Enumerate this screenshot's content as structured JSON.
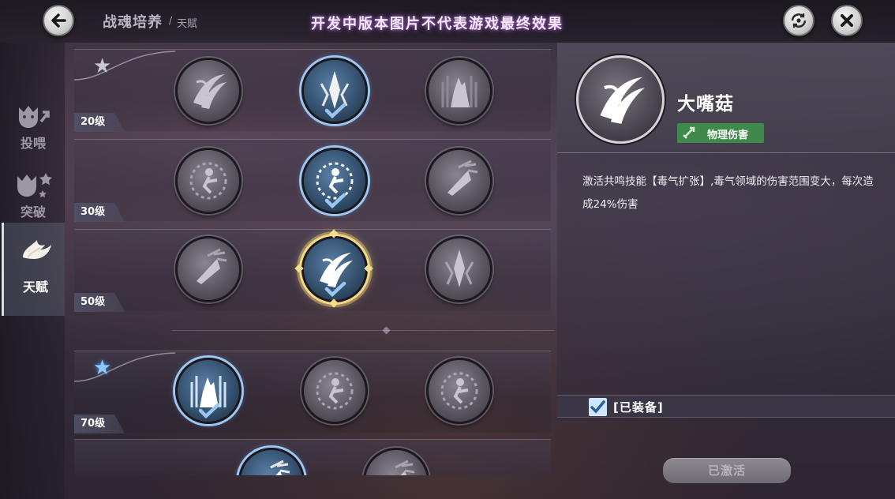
{
  "header": {
    "title": "战魂培养",
    "separator": "/",
    "subtitle": "天赋",
    "notice": "开发中版本图片不代表游戏最终效果"
  },
  "nav": {
    "items": [
      {
        "label": "投喂",
        "icon": "beast-feed-icon"
      },
      {
        "label": "突破",
        "icon": "beast-star-icon"
      },
      {
        "label": "天赋",
        "icon": "flame-icon",
        "active": true
      }
    ]
  },
  "tiers": [
    {
      "level": "20级",
      "star": "gray",
      "skills": [
        {
          "icon": "claw-slash-icon",
          "state": "locked"
        },
        {
          "icon": "fang-shard-icon",
          "state": "equipped"
        },
        {
          "icon": "wolf-howl-icon",
          "state": "locked"
        }
      ]
    },
    {
      "level": "30级",
      "star": "none",
      "skills": [
        {
          "icon": "thorn-figure-icon",
          "state": "locked"
        },
        {
          "icon": "thorn-figure-icon",
          "state": "equipped"
        },
        {
          "icon": "arrow-burst-icon",
          "state": "locked"
        }
      ]
    },
    {
      "level": "50级",
      "star": "none",
      "skills": [
        {
          "icon": "arrow-burst-icon",
          "state": "locked"
        },
        {
          "icon": "claw-slash-icon",
          "state": "selected"
        },
        {
          "icon": "fang-shard-icon",
          "state": "locked"
        }
      ]
    },
    {
      "level": "70级",
      "star": "blue",
      "skills": [
        {
          "icon": "wolf-howl-icon",
          "state": "equipped"
        },
        {
          "icon": "thorn-figure-icon",
          "state": "locked"
        },
        {
          "icon": "thorn-figure-icon",
          "state": "locked"
        }
      ]
    }
  ],
  "detail": {
    "name": "大嘴菇",
    "tag": "物理伤害",
    "description": "激活共鸣技能【毒气扩张】,毒气领域的伤害范围变大，每次造成24%伤害",
    "equipped_label": "[已装备]",
    "activated_label": "已激活"
  },
  "colors": {
    "accent_blue": "#9cc6f2",
    "selected_gold": "#f1d98a",
    "tag_green": "#3f8a4b",
    "notice_glow": "#b46bd4"
  }
}
